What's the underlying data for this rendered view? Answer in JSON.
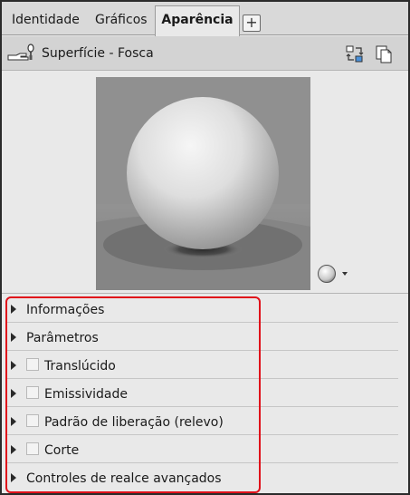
{
  "tabs": [
    {
      "label": "Identidade",
      "active": false
    },
    {
      "label": "Gráficos",
      "active": false
    },
    {
      "label": "Aparência",
      "active": true
    }
  ],
  "tab_add_label": "+",
  "header": {
    "material_name": "Superfície - Fosca",
    "icons": [
      "hand-material-icon",
      "replace-asset-icon",
      "duplicate-asset-icon"
    ]
  },
  "preview": {
    "shape_options_icon": "sphere-icon",
    "dropdown_icon": "caret-down-icon"
  },
  "sections": [
    {
      "label": "Informações",
      "has_checkbox": false,
      "checked": false
    },
    {
      "label": "Parâmetros",
      "has_checkbox": false,
      "checked": false
    },
    {
      "label": "Translúcido",
      "has_checkbox": true,
      "checked": false
    },
    {
      "label": "Emissividade",
      "has_checkbox": true,
      "checked": false
    },
    {
      "label": "Padrão de liberação (relevo)",
      "has_checkbox": true,
      "checked": false
    },
    {
      "label": "Corte",
      "has_checkbox": true,
      "checked": false
    },
    {
      "label": "Controles de realce avançados",
      "has_checkbox": false,
      "checked": false
    }
  ],
  "colors": {
    "highlight": "#e0101a",
    "panel_bg": "#e9e9e9",
    "header_bg": "#d3d3d3"
  }
}
